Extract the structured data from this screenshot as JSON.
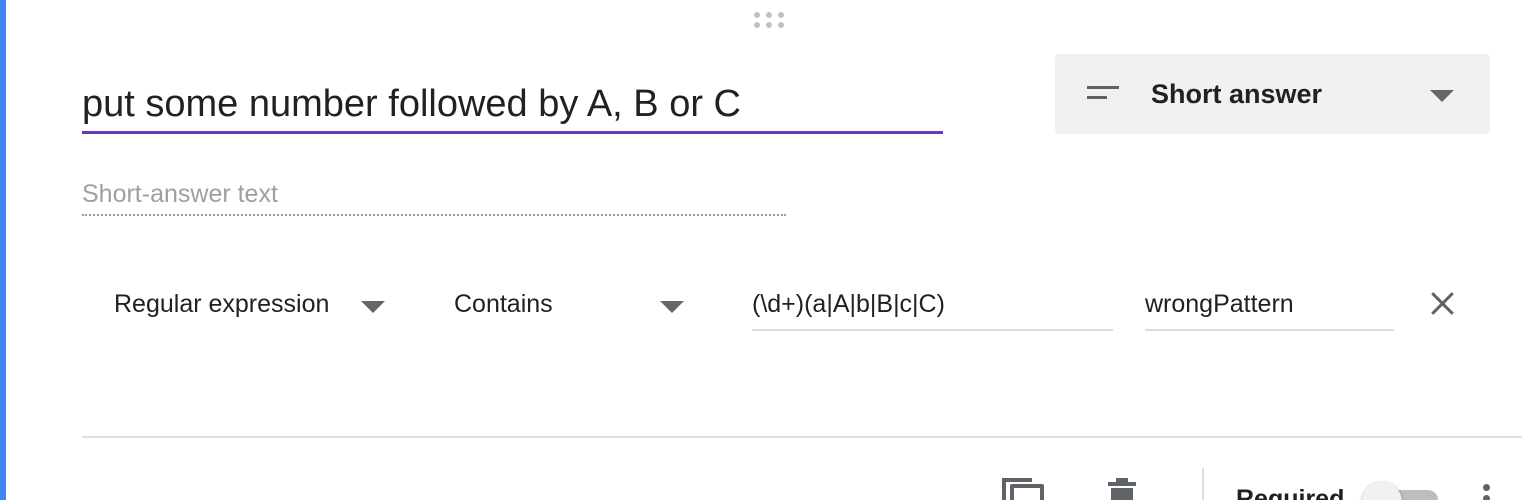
{
  "question": {
    "title": "put some number followed by A, B or C"
  },
  "question_type": {
    "icon": "short-text-icon",
    "label": "Short answer"
  },
  "answer": {
    "placeholder": "Short-answer text"
  },
  "validation": {
    "type_label": "Regular expression",
    "condition_label": "Contains",
    "pattern_value": "(\\d+)(a|A|b|B|c|C)",
    "error_text_value": "wrongPattern"
  },
  "footer": {
    "required_label": "Required",
    "required_on": false
  },
  "colors": {
    "accent_bar": "#4285f4",
    "title_underline": "#673ab7"
  }
}
